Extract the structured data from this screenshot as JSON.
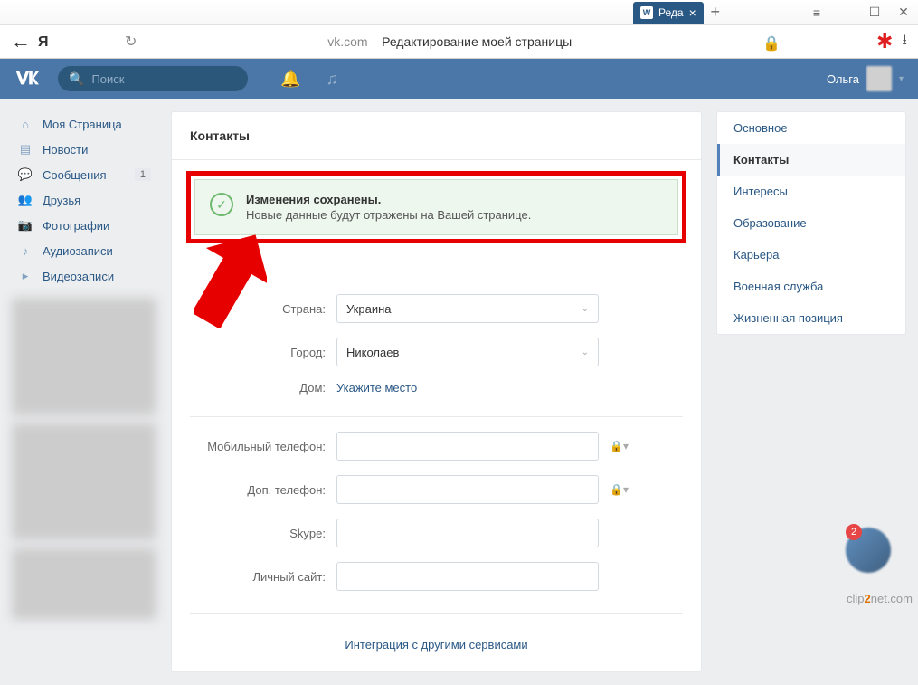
{
  "browser": {
    "tab_title": "Реда",
    "address_domain": "vk.com",
    "address_title": "Редактирование моей страницы"
  },
  "header": {
    "search_placeholder": "Поиск",
    "user_name": "Ольга"
  },
  "sidebar": {
    "items": [
      {
        "label": "Моя Страница"
      },
      {
        "label": "Новости"
      },
      {
        "label": "Сообщения",
        "badge": "1"
      },
      {
        "label": "Друзья"
      },
      {
        "label": "Фотографии"
      },
      {
        "label": "Аудиозаписи"
      },
      {
        "label": "Видеозаписи"
      }
    ]
  },
  "main": {
    "title": "Контакты",
    "alert": {
      "title": "Изменения сохранены.",
      "text": "Новые данные будут отражены на Вашей странице."
    },
    "form": {
      "country_label": "Страна:",
      "country_value": "Украина",
      "city_label": "Город:",
      "city_value": "Николаев",
      "home_label": "Дом:",
      "home_link": "Укажите место",
      "mobile_label": "Мобильный телефон:",
      "extra_phone_label": "Доп. телефон:",
      "skype_label": "Skype:",
      "site_label": "Личный сайт:"
    },
    "integration": "Интеграция с другими сервисами"
  },
  "rsidebar": {
    "items": [
      "Основное",
      "Контакты",
      "Интересы",
      "Образование",
      "Карьера",
      "Военная служба",
      "Жизненная позиция"
    ],
    "active_index": 1
  },
  "notif_count": "2",
  "watermark": {
    "pre": "clip",
    "mid": "2",
    "post": "net.com"
  }
}
